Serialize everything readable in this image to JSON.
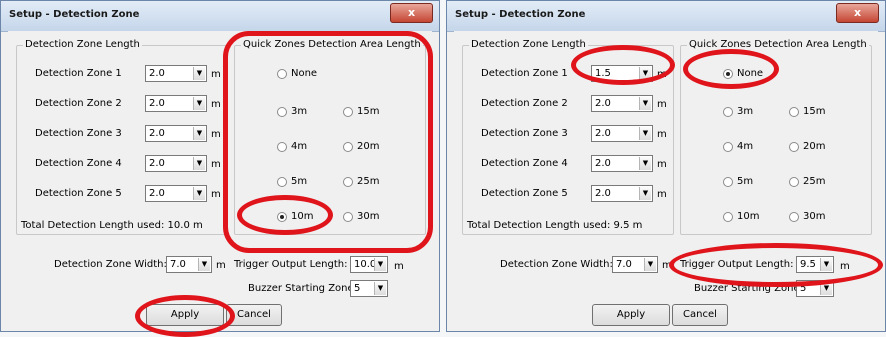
{
  "colors": {
    "highlight": "#e0141b",
    "close_button": "#c54634"
  },
  "windows": [
    {
      "title": "Setup - Detection Zone",
      "close_glyph": "x",
      "length_group": "Detection Zone Length",
      "zones": [
        {
          "label": "Detection Zone 1",
          "value": "2.0",
          "unit": "m"
        },
        {
          "label": "Detection Zone 2",
          "value": "2.0",
          "unit": "m"
        },
        {
          "label": "Detection Zone 3",
          "value": "2.0",
          "unit": "m"
        },
        {
          "label": "Detection Zone 4",
          "value": "2.0",
          "unit": "m"
        },
        {
          "label": "Detection Zone 5",
          "value": "2.0",
          "unit": "m"
        }
      ],
      "total_text": "Total Detection Length used: 10.0 m",
      "quick_group": "Quick Zones Detection Area Length",
      "radios": [
        "None",
        "3m",
        "15m",
        "4m",
        "20m",
        "5m",
        "25m",
        "10m",
        "30m"
      ],
      "selected_radio": "10m",
      "width_label": "Detection Zone Width:",
      "width_value": "7.0",
      "width_unit": "m",
      "trigger_label": "Trigger Output Length:",
      "trigger_value": "10.0",
      "trigger_unit": "m",
      "buzzer_label": "Buzzer Starting Zone:",
      "buzzer_value": "5",
      "apply_label": "Apply",
      "cancel_label": "Cancel"
    },
    {
      "title": "Setup - Detection Zone",
      "close_glyph": "x",
      "length_group": "Detection Zone Length",
      "zones": [
        {
          "label": "Detection Zone 1",
          "value": "1.5",
          "unit": "m"
        },
        {
          "label": "Detection Zone 2",
          "value": "2.0",
          "unit": "m"
        },
        {
          "label": "Detection Zone 3",
          "value": "2.0",
          "unit": "m"
        },
        {
          "label": "Detection Zone 4",
          "value": "2.0",
          "unit": "m"
        },
        {
          "label": "Detection Zone 5",
          "value": "2.0",
          "unit": "m"
        }
      ],
      "total_text": "Total Detection Length used: 9.5 m",
      "quick_group": "Quick Zones Detection Area Length",
      "radios": [
        "None",
        "3m",
        "15m",
        "4m",
        "20m",
        "5m",
        "25m",
        "10m",
        "30m"
      ],
      "selected_radio": "None",
      "width_label": "Detection Zone Width:",
      "width_value": "7.0",
      "width_unit": "m",
      "trigger_label": "Trigger Output Length:",
      "trigger_value": "9.5",
      "trigger_unit": "m",
      "buzzer_label": "Buzzer Starting Zone:",
      "buzzer_value": "5",
      "apply_label": "Apply",
      "cancel_label": "Cancel"
    }
  ]
}
